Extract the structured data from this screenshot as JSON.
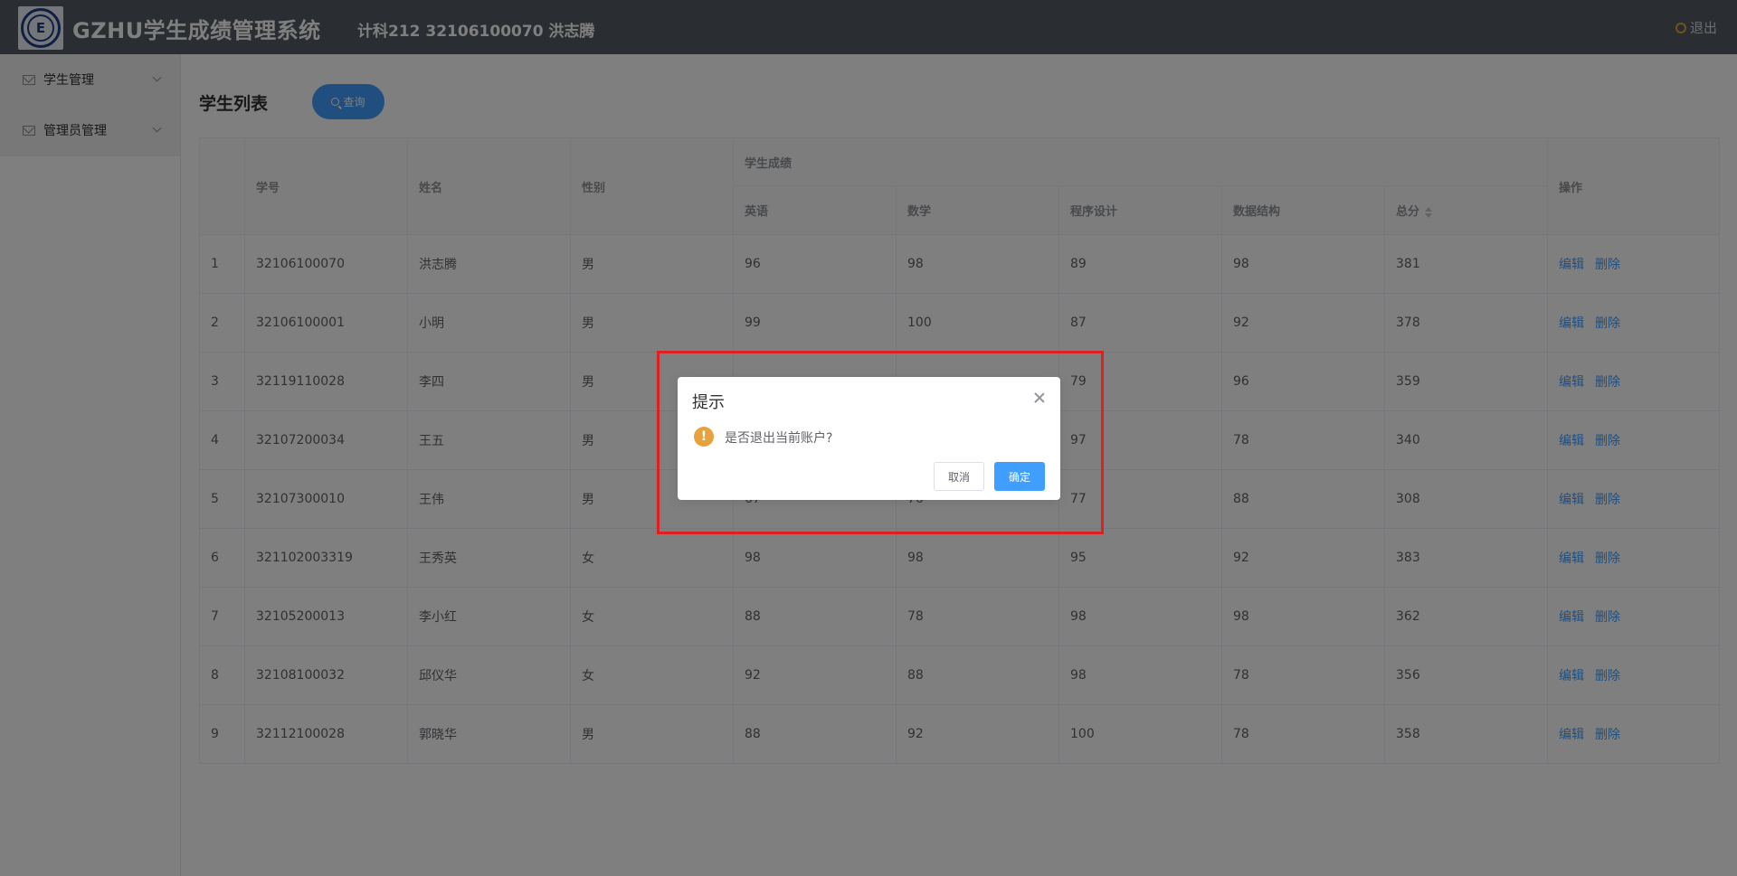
{
  "header": {
    "system_title": "GZHU学生成绩管理系统",
    "user_info": "计科212 32106100070 洪志腾",
    "logout_label": "退出"
  },
  "sidebar": {
    "items": [
      {
        "label": "学生管理"
      },
      {
        "label": "管理员管理"
      }
    ]
  },
  "main": {
    "page_title": "学生列表",
    "query_label": "查询"
  },
  "table": {
    "headers": {
      "student_id": "学号",
      "name": "姓名",
      "gender": "性别",
      "scores_group": "学生成绩",
      "english": "英语",
      "math": "数学",
      "programming": "程序设计",
      "data_structure": "数据结构",
      "total": "总分",
      "operation": "操作"
    },
    "edit_label": "编辑",
    "delete_label": "删除",
    "rows": [
      {
        "idx": "1",
        "id": "32106100070",
        "name": "洪志腾",
        "gender": "男",
        "english": "96",
        "math": "98",
        "programming": "89",
        "ds": "98",
        "total": "381"
      },
      {
        "idx": "2",
        "id": "32106100001",
        "name": "小明",
        "gender": "男",
        "english": "99",
        "math": "100",
        "programming": "87",
        "ds": "92",
        "total": "378"
      },
      {
        "idx": "3",
        "id": "32119110028",
        "name": "李四",
        "gender": "男",
        "english": "",
        "math": "",
        "programming": "79",
        "ds": "96",
        "total": "359"
      },
      {
        "idx": "4",
        "id": "32107200034",
        "name": "王五",
        "gender": "男",
        "english": "",
        "math": "",
        "programming": "97",
        "ds": "78",
        "total": "340"
      },
      {
        "idx": "5",
        "id": "32107300010",
        "name": "王伟",
        "gender": "男",
        "english": "67",
        "math": "76",
        "programming": "77",
        "ds": "88",
        "total": "308"
      },
      {
        "idx": "6",
        "id": "321102003319",
        "name": "王秀英",
        "gender": "女",
        "english": "98",
        "math": "98",
        "programming": "95",
        "ds": "92",
        "total": "383"
      },
      {
        "idx": "7",
        "id": "32105200013",
        "name": "李小红",
        "gender": "女",
        "english": "88",
        "math": "78",
        "programming": "98",
        "ds": "98",
        "total": "362"
      },
      {
        "idx": "8",
        "id": "32108100032",
        "name": "邱仪华",
        "gender": "女",
        "english": "92",
        "math": "88",
        "programming": "98",
        "ds": "78",
        "total": "356"
      },
      {
        "idx": "9",
        "id": "32112100028",
        "name": "郭晓华",
        "gender": "男",
        "english": "88",
        "math": "92",
        "programming": "100",
        "ds": "78",
        "total": "358"
      }
    ]
  },
  "dialog": {
    "title": "提示",
    "message": "是否退出当前账户?",
    "cancel_label": "取消",
    "confirm_label": "确定"
  },
  "colors": {
    "header_bg": "#545c64",
    "primary": "#409eff",
    "warning": "#e6a23c",
    "highlight_border": "#e02020"
  }
}
